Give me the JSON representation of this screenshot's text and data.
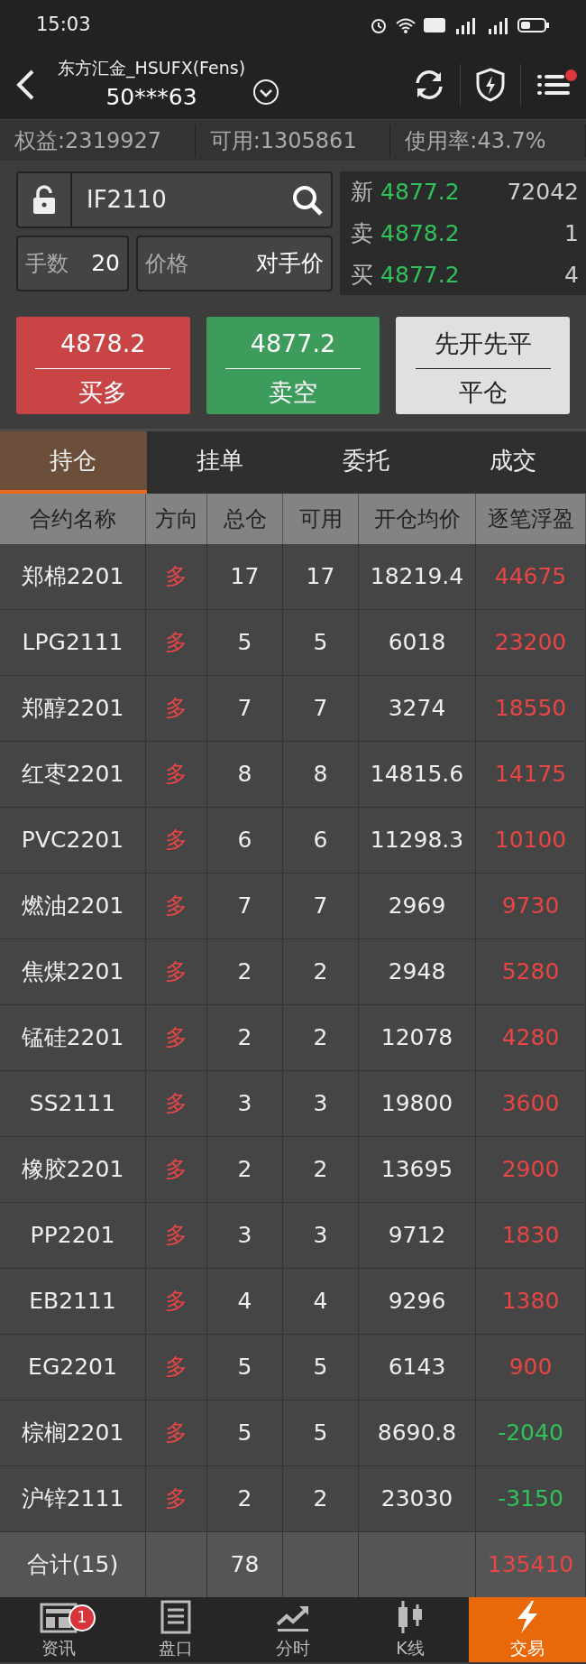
{
  "status_bar": {
    "time": "15:03"
  },
  "header": {
    "title": "东方汇金_HSUFX(Fens)",
    "account": "50***63",
    "menu_badge": true
  },
  "summary": [
    {
      "text": "权益:2319927"
    },
    {
      "text": "可用:1305861"
    },
    {
      "text": "使用率:43.7%"
    }
  ],
  "order": {
    "locked": false,
    "symbol": "IF2110",
    "quantity_label": "手数",
    "quantity": "20",
    "price_label": "价格",
    "price": "对手价",
    "quote": [
      {
        "label": "新",
        "price": "4877.2",
        "volume": "72042"
      },
      {
        "label": "卖",
        "price": "4878.2",
        "volume": "1"
      },
      {
        "label": "买",
        "price": "4877.2",
        "volume": "4"
      }
    ],
    "buttons": [
      {
        "kind": "buy",
        "price": "4878.2",
        "label": "买多"
      },
      {
        "kind": "sell",
        "price": "4877.2",
        "label": "卖空"
      },
      {
        "kind": "close",
        "price": "先开先平",
        "label": "平仓"
      }
    ]
  },
  "tabs": [
    {
      "label": "持仓",
      "selected": true
    },
    {
      "label": "挂单",
      "selected": false
    },
    {
      "label": "委托",
      "selected": false
    },
    {
      "label": "成交",
      "selected": false
    }
  ],
  "table": {
    "columns": [
      "合约名称",
      "方向",
      "总仓",
      "可用",
      "开仓均价",
      "逐笔浮盈"
    ],
    "rows": [
      {
        "name": "郑棉2201",
        "direction": "多",
        "total": "17",
        "available": "17",
        "avg_price": "18219.4",
        "pnl": "44675",
        "color": "#e84545"
      },
      {
        "name": "LPG2111",
        "direction": "多",
        "total": "5",
        "available": "5",
        "avg_price": "6018",
        "pnl": "23200",
        "color": "#e84545"
      },
      {
        "name": "郑醇2201",
        "direction": "多",
        "total": "7",
        "available": "7",
        "avg_price": "3274",
        "pnl": "18550",
        "color": "#e84545"
      },
      {
        "name": "红枣2201",
        "direction": "多",
        "total": "8",
        "available": "8",
        "avg_price": "14815.6",
        "pnl": "14175",
        "color": "#e84545"
      },
      {
        "name": "PVC2201",
        "direction": "多",
        "total": "6",
        "available": "6",
        "avg_price": "11298.3",
        "pnl": "10100",
        "color": "#e84545"
      },
      {
        "name": "燃油2201",
        "direction": "多",
        "total": "7",
        "available": "7",
        "avg_price": "2969",
        "pnl": "9730",
        "color": "#e84545"
      },
      {
        "name": "焦煤2201",
        "direction": "多",
        "total": "2",
        "available": "2",
        "avg_price": "2948",
        "pnl": "5280",
        "color": "#e84545"
      },
      {
        "name": "锰硅2201",
        "direction": "多",
        "total": "2",
        "available": "2",
        "avg_price": "12078",
        "pnl": "4280",
        "color": "#e84545"
      },
      {
        "name": "SS2111",
        "direction": "多",
        "total": "3",
        "available": "3",
        "avg_price": "19800",
        "pnl": "3600",
        "color": "#e84545"
      },
      {
        "name": "橡胶2201",
        "direction": "多",
        "total": "2",
        "available": "2",
        "avg_price": "13695",
        "pnl": "2900",
        "color": "#e84545"
      },
      {
        "name": "PP2201",
        "direction": "多",
        "total": "3",
        "available": "3",
        "avg_price": "9712",
        "pnl": "1830",
        "color": "#e84545"
      },
      {
        "name": "EB2111",
        "direction": "多",
        "total": "4",
        "available": "4",
        "avg_price": "9296",
        "pnl": "1380",
        "color": "#e84545"
      },
      {
        "name": "EG2201",
        "direction": "多",
        "total": "5",
        "available": "5",
        "avg_price": "6143",
        "pnl": "900",
        "color": "#e84545"
      },
      {
        "name": "棕榈2201",
        "direction": "多",
        "total": "5",
        "available": "5",
        "avg_price": "8690.8",
        "pnl": "-2040",
        "color": "#2fc25b"
      },
      {
        "name": "沪锌2111",
        "direction": "多",
        "total": "2",
        "available": "2",
        "avg_price": "23030",
        "pnl": "-3150",
        "color": "#2fc25b"
      }
    ],
    "total": {
      "label": "合计(15)",
      "total": "78",
      "pnl": "135410"
    }
  },
  "bottom_nav": [
    {
      "label": "资讯",
      "badge": "1",
      "selected": false
    },
    {
      "label": "盘口",
      "selected": false
    },
    {
      "label": "分时",
      "selected": false
    },
    {
      "label": "K线",
      "selected": false
    },
    {
      "label": "交易",
      "selected": true
    }
  ]
}
